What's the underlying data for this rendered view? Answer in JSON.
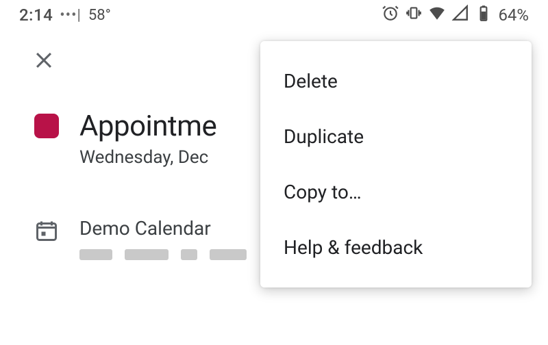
{
  "statusbar": {
    "time": "2:14",
    "dots": "•••|",
    "temperature": "58°",
    "battery_percent": "64%"
  },
  "event": {
    "title": "Appointme",
    "date_line": "Wednesday, Dec",
    "calendar_name": "Demo Calendar",
    "color": "#b81248"
  },
  "menu": {
    "items": [
      {
        "label": "Delete"
      },
      {
        "label": "Duplicate"
      },
      {
        "label": "Copy to…"
      },
      {
        "label": "Help & feedback"
      }
    ]
  }
}
